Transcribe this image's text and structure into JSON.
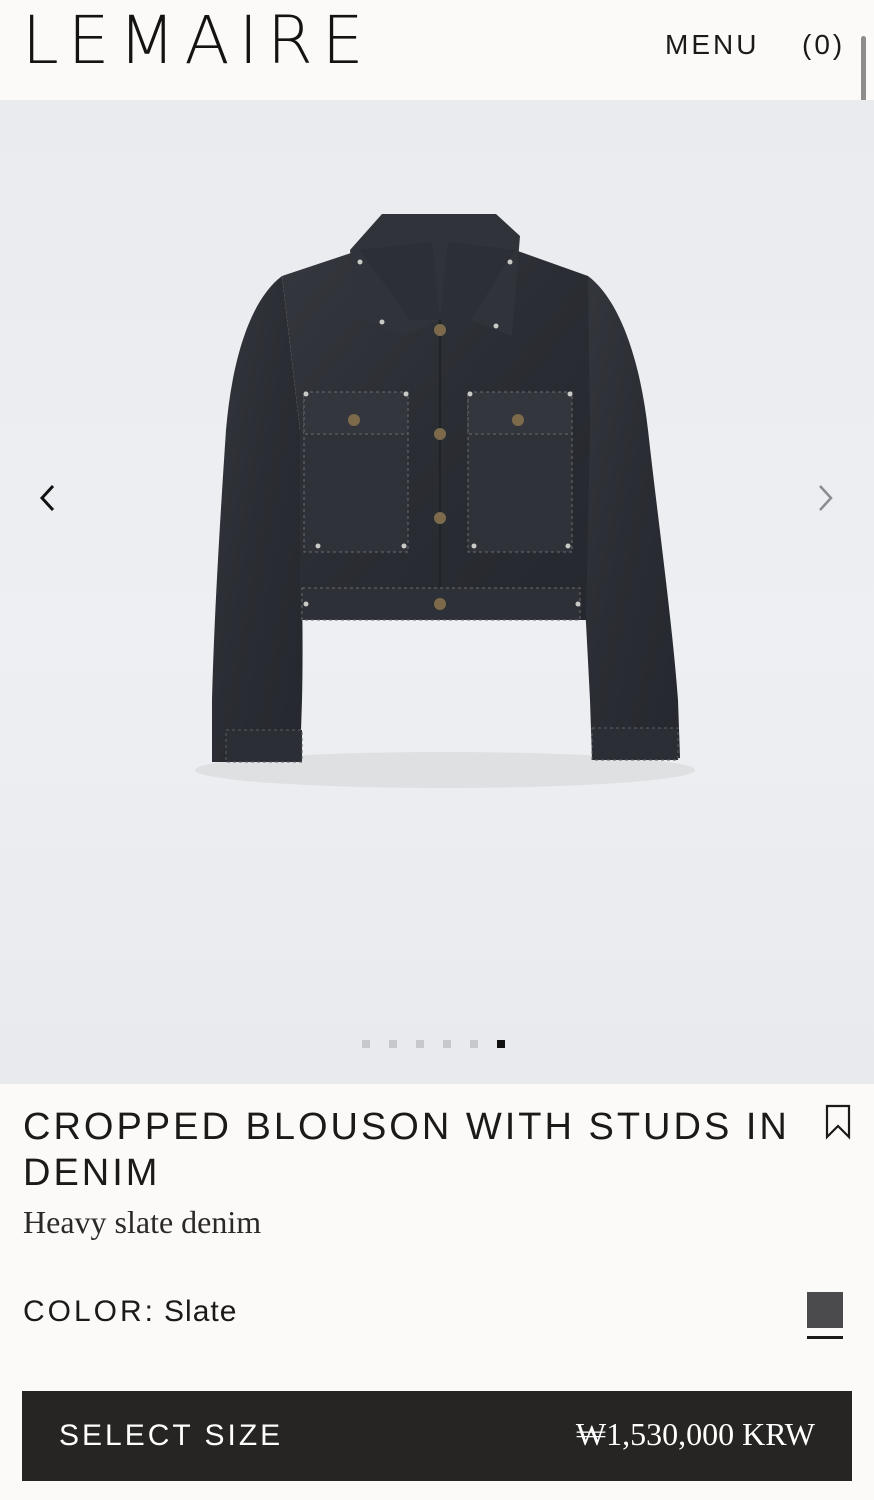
{
  "header": {
    "logo": "LEMAIRE",
    "menu_label": "MENU",
    "cart_label": "(0)"
  },
  "gallery": {
    "image_count": 6,
    "active_index": 5,
    "prev_icon": "chevron-left-icon",
    "next_icon": "chevron-right-icon"
  },
  "product": {
    "title": "CROPPED BLOUSON WITH STUDS IN DENIM",
    "subtitle": "Heavy slate denim",
    "color_label": "COLOR:",
    "color_value": "Slate",
    "swatch_color": "#4b4b4d",
    "select_size_label": "SELECT SIZE",
    "price": "₩1,530,000 KRW"
  },
  "colors": {
    "background": "#fbfaf8",
    "text": "#1b1a18",
    "button_bg": "#262523",
    "gallery_bg": "#eceef1"
  }
}
